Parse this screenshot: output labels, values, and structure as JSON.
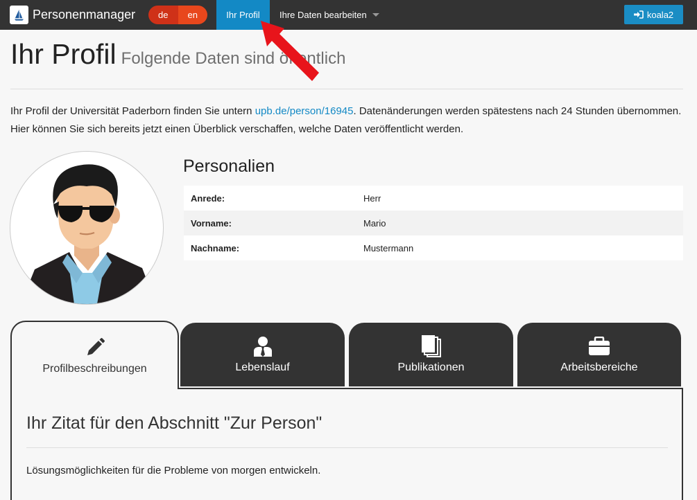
{
  "navbar": {
    "brand": "Personenmanager",
    "lang_de": "de",
    "lang_en": "en",
    "nav_profil": "Ihr Profil",
    "nav_edit": "Ihre Daten bearbeiten",
    "login_button": "koala2"
  },
  "header": {
    "title": "Ihr Profil",
    "subtitle": "Folgende Daten sind öffentlich"
  },
  "intro": {
    "text_before": "Ihr Profil der Universität Paderborn finden Sie untern ",
    "link": "upb.de/person/16945",
    "text_after": ". Datenänderungen werden spätestens nach 24 Stunden übernommen. Hier können Sie sich bereits jetzt einen Überblick verschaffen, welche Daten veröffentlicht werden."
  },
  "personalien": {
    "title": "Personalien",
    "rows": [
      {
        "label": "Anrede:",
        "value": "Herr"
      },
      {
        "label": "Vorname:",
        "value": "Mario"
      },
      {
        "label": "Nachname:",
        "value": "Mustermann"
      }
    ]
  },
  "tabs": [
    {
      "label": "Profilbeschreibungen",
      "icon": "pencil-icon",
      "active": true
    },
    {
      "label": "Lebenslauf",
      "icon": "user-tie-icon",
      "active": false
    },
    {
      "label": "Publikationen",
      "icon": "documents-icon",
      "active": false
    },
    {
      "label": "Arbeitsbereiche",
      "icon": "briefcase-icon",
      "active": false
    }
  ],
  "content": {
    "quote_title": "Ihr Zitat für den Abschnitt \"Zur Person\"",
    "quote_text": "Lösungsmöglichkeiten für die Probleme von morgen entwickeln."
  },
  "colors": {
    "navbar_bg": "#333333",
    "nav_active": "#1389c5",
    "lang_de": "#cf3118",
    "lang_en": "#e8471c",
    "link": "#1389c5",
    "arrow": "#e8141b"
  }
}
